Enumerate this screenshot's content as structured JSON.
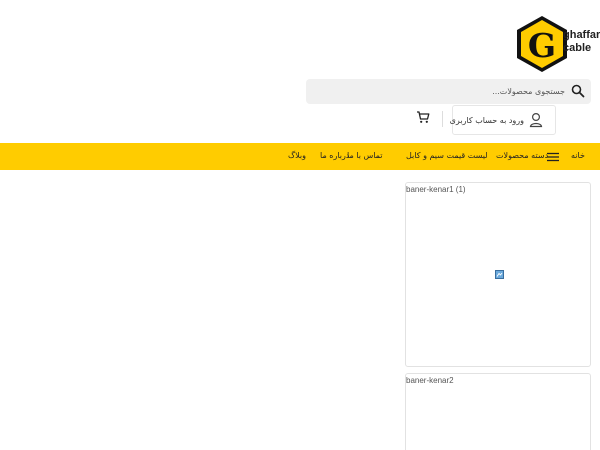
{
  "header": {
    "logo": {
      "letter": "G",
      "line1": "ghaffari",
      "line2": "cable",
      "hex_color": "#ffcc00"
    },
    "search": {
      "placeholder": "جستجوی محصولات..."
    },
    "account": {
      "label": "ورود به حساب کاربری"
    }
  },
  "nav": {
    "items": [
      {
        "label": "خانه"
      },
      {
        "label": "دسته محصولات"
      },
      {
        "label": "لیست قیمت سیم و کابل"
      },
      {
        "label": "تماس با ما"
      },
      {
        "label": "درباره ما"
      },
      {
        "label": "وبلاگ"
      }
    ],
    "background": "#ffcc00"
  },
  "sidebar": {
    "banners": [
      {
        "alt": "baner-kenar1 (1)"
      },
      {
        "alt": "baner-kenar2"
      }
    ]
  },
  "icons": [
    "search-icon",
    "user-icon",
    "cart-icon",
    "menu-icon",
    "broken-image-icon"
  ]
}
